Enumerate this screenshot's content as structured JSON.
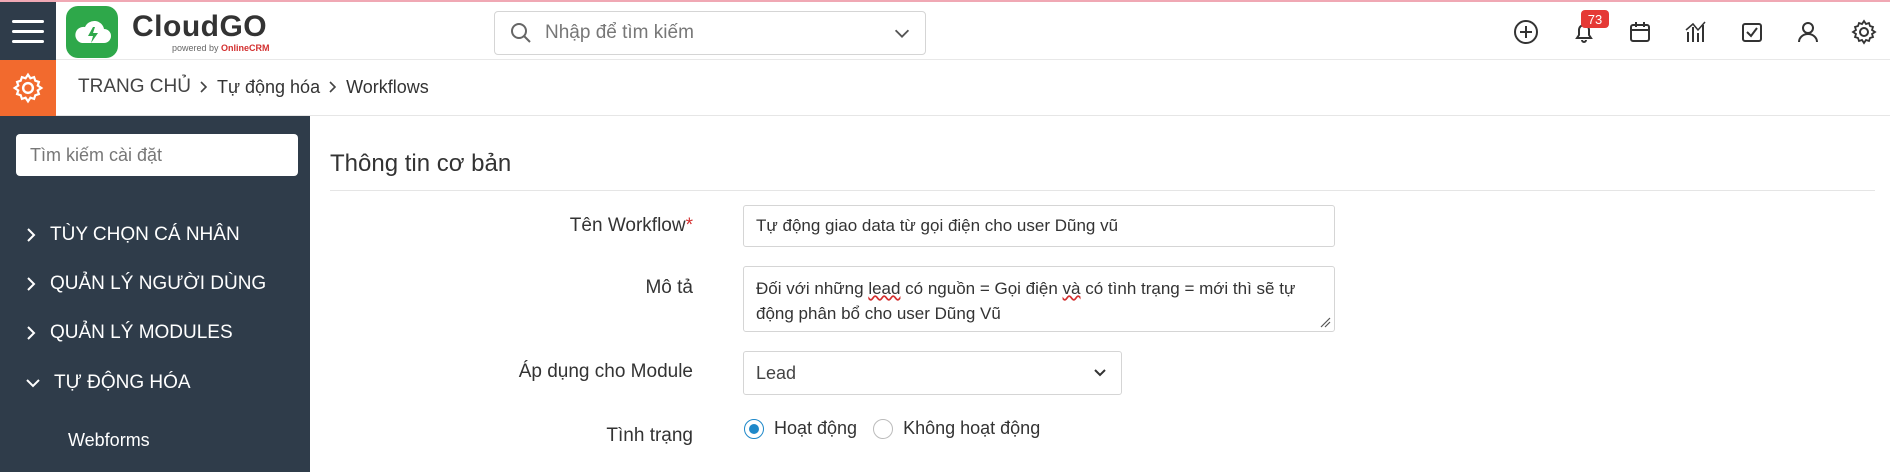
{
  "app": {
    "logo_title": "CloudGO",
    "logo_powered_by": "powered by",
    "logo_partner": "OnlineCRM"
  },
  "header": {
    "search_placeholder": "Nhập để tìm kiếm",
    "notification_count": "73",
    "icons": [
      "plus-circle-icon",
      "bell-icon",
      "calendar-icon",
      "chart-icon",
      "checkbox-icon",
      "user-icon",
      "gear-icon"
    ]
  },
  "breadcrumb": {
    "home": "TRANG CHỦ",
    "level1": "Tự động hóa",
    "level2": "Workflows"
  },
  "sidebar": {
    "search_placeholder": "Tìm kiếm cài đặt",
    "items": [
      {
        "label": "TÙY CHỌN CÁ NHÂN",
        "expanded": false
      },
      {
        "label": "QUẢN LÝ NGƯỜI DÙNG",
        "expanded": false
      },
      {
        "label": "QUẢN LÝ MODULES",
        "expanded": false
      },
      {
        "label": "TỰ ĐỘNG HÓA",
        "expanded": true
      }
    ],
    "subitem": "Webforms"
  },
  "form": {
    "section_title": "Thông tin cơ bản",
    "name_label": "Tên Workflow",
    "name_required": "*",
    "name_value": "Tự động giao data từ gọi điện cho user Dũng vũ",
    "desc_label": "Mô tả",
    "desc_part1": "Đối với những ",
    "desc_part2": "lead",
    "desc_part3": " có nguồn = Gọi điện ",
    "desc_part4": "và",
    "desc_part5": " có tình trạng = mới thì sẽ tự động phân bổ cho user Dũng Vũ",
    "module_label": "Áp dụng cho Module",
    "module_value": "Lead",
    "status_label": "Tình trạng",
    "status_active": "Hoạt động",
    "status_inactive": "Không hoạt động",
    "status_selected": "Hoạt động"
  },
  "colors": {
    "sidebar_bg": "#2f3c4a",
    "accent_orange": "#f26a2e",
    "brand_green": "#2ea84a",
    "radio_blue": "#1e88c9",
    "badge_red": "#e53935"
  }
}
